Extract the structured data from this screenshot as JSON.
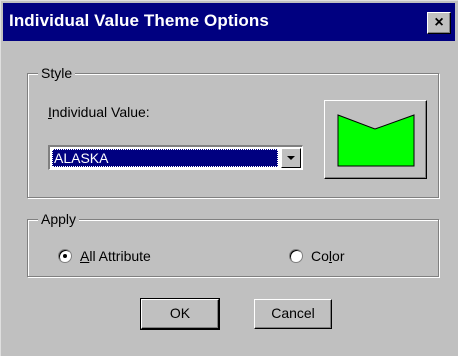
{
  "window": {
    "title": "Individual Value Theme Options",
    "close_glyph": "×"
  },
  "style_group": {
    "label": "Style",
    "field_label": "Individual Value:",
    "field_label_underline": "I",
    "field_label_rest": "ndividual Value:",
    "selected_value": "ALASKA",
    "preview_fill_color": "#00ff00"
  },
  "apply_group": {
    "label": "Apply",
    "options": [
      {
        "label": "All Attribute",
        "underline": "A",
        "rest": "ll Attribute",
        "selected": true
      },
      {
        "label": "Color",
        "pre": "Co",
        "underline": "l",
        "rest": "or",
        "selected": false
      }
    ]
  },
  "buttons": {
    "ok": "OK",
    "cancel": "Cancel"
  },
  "colors": {
    "titlebar": "#000080",
    "face": "#c0c0c0",
    "selection": "#000080"
  }
}
